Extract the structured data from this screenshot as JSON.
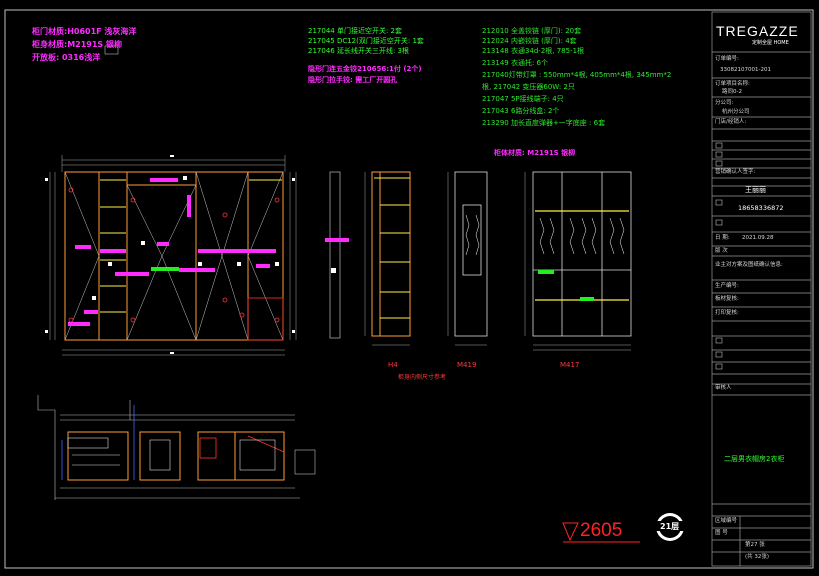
{
  "legend": {
    "door_material": "柜门材质:H0601F 浅灰海洋",
    "body_material": "柜身材质:M2191S 银柳",
    "handle": "开放板: 0316浅洋"
  },
  "notes_col1": [
    "217044  单门接近空开关: 2套",
    "217045  DC12(双门接近空开关: 1套",
    "217046  延长线开关三开线: 3根"
  ],
  "notes_col1_pink": [
    "隐形门连五金铰210656:1付 (2个)",
    "隐形门拉手铰: 需工厂开圆孔"
  ],
  "notes_col2": [
    "212010  全盖铰链 (厚门): 20套",
    "212024  内嵌铰链 (厚门): 4套",
    "213148  衣通34d-2根, 785-1根",
    "213149  衣通托: 6个",
    "217040灯带灯罩 : 550mm*4根, 405mm*4根, 345mm*2",
    "根, 217042 变压器60W: 2只",
    "217047  5P接线端子: 4只",
    "217043  6路分线盒: 2个",
    "213290  加长直度弹器+一字底座 : 6套"
  ],
  "cabinet_body_note": "柜体材质: M2191S 银柳",
  "dimension": "2605",
  "floor_badge": "21层",
  "section_labels": {
    "h4": "H4",
    "h4_sub": "柜身内侧尺寸参考",
    "m419": "M419",
    "m417": "M417"
  },
  "title_block": {
    "logo": "TREGAZZE",
    "logo_sub": "定制全屋 HOME",
    "order_label": "订单编号:",
    "order_number": "33082107001-201",
    "project_label": "订单项目名称:",
    "project_value": "路同0-2",
    "company_label": "分公司:",
    "company_value": "杭州分公司",
    "store_label": "门店/经销人:",
    "designer_label": "营销确认人签字:",
    "designer_name": "王丽丽",
    "phone": "18658336872",
    "date_label": "日    期:",
    "date_value": "2021.09.28",
    "version_label": "版    次",
    "confirm_label": "业主对方案及图纸确认信息:",
    "owner_label": "生产编号:",
    "check_label": "板材复核:",
    "print_label": "打印复核:",
    "review_label": "审核人",
    "drawing_title": "二层男衣帽房2衣柜",
    "area_label": "区域编号",
    "sheet_label": "图    号",
    "page_label": "第27 张",
    "total_label": "(共 32张)"
  }
}
